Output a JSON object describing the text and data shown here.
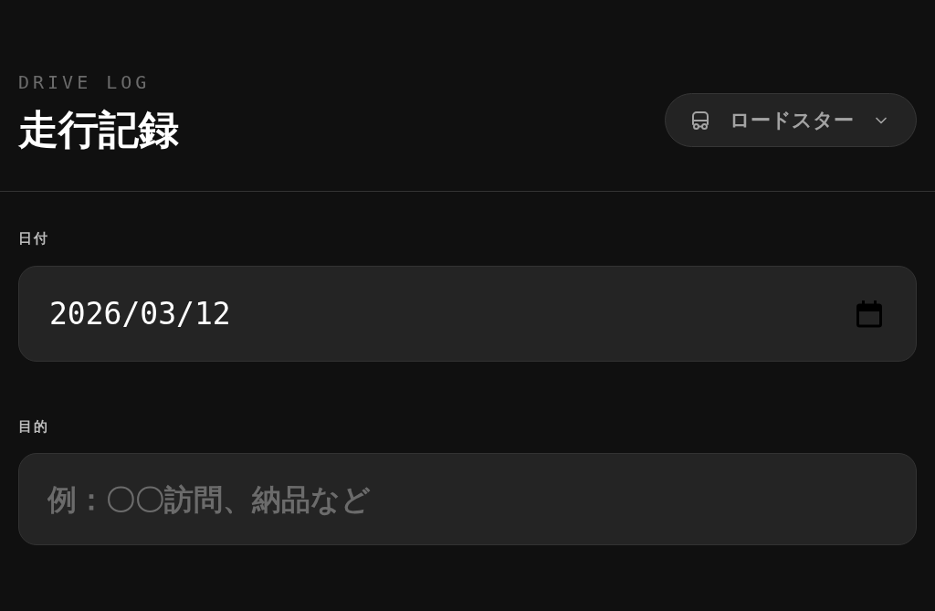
{
  "header": {
    "eyebrow": "DRIVE LOG",
    "title": "走行記録",
    "vehicle_select": {
      "value": "ロードスター"
    }
  },
  "fields": [
    {
      "kind": "date",
      "label": "日付",
      "value": "2026/03/12"
    },
    {
      "kind": "text",
      "label": "目的",
      "placeholder": "例：〇〇訪問、納品など"
    }
  ]
}
